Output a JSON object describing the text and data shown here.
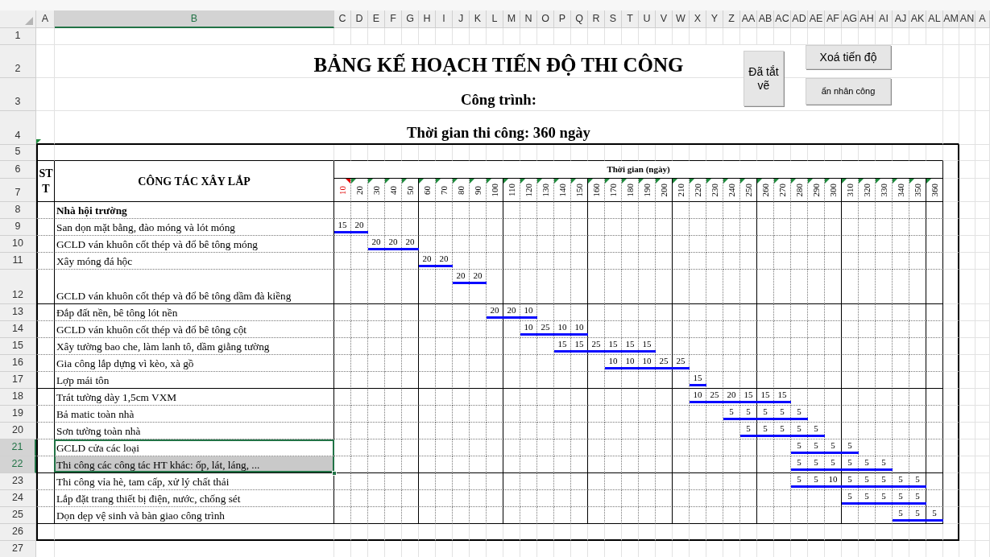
{
  "column_headers": [
    {
      "label": "A",
      "selected": false
    },
    {
      "label": "B",
      "selected": true
    },
    {
      "label": "C",
      "selected": false
    },
    {
      "label": "D",
      "selected": false
    },
    {
      "label": "E",
      "selected": false
    },
    {
      "label": "F",
      "selected": false
    },
    {
      "label": "G",
      "selected": false
    },
    {
      "label": "H",
      "selected": false
    },
    {
      "label": "I",
      "selected": false
    },
    {
      "label": "J",
      "selected": false
    },
    {
      "label": "K",
      "selected": false
    },
    {
      "label": "L",
      "selected": false
    },
    {
      "label": "M",
      "selected": false
    },
    {
      "label": "N",
      "selected": false
    },
    {
      "label": "O",
      "selected": false
    },
    {
      "label": "P",
      "selected": false
    },
    {
      "label": "Q",
      "selected": false
    },
    {
      "label": "R",
      "selected": false
    },
    {
      "label": "S",
      "selected": false
    },
    {
      "label": "T",
      "selected": false
    },
    {
      "label": "U",
      "selected": false
    },
    {
      "label": "V",
      "selected": false
    },
    {
      "label": "W",
      "selected": false
    },
    {
      "label": "X",
      "selected": false
    },
    {
      "label": "Y",
      "selected": false
    },
    {
      "label": "Z",
      "selected": false
    },
    {
      "label": "AA",
      "selected": false
    },
    {
      "label": "AB",
      "selected": false
    },
    {
      "label": "AC",
      "selected": false
    },
    {
      "label": "AD",
      "selected": false
    },
    {
      "label": "AE",
      "selected": false
    },
    {
      "label": "AF",
      "selected": false
    },
    {
      "label": "AG",
      "selected": false
    },
    {
      "label": "AH",
      "selected": false
    },
    {
      "label": "AI",
      "selected": false
    },
    {
      "label": "AJ",
      "selected": false
    },
    {
      "label": "AK",
      "selected": false
    },
    {
      "label": "AL",
      "selected": false
    },
    {
      "label": "AM",
      "selected": false
    },
    {
      "label": "AN",
      "selected": false
    },
    {
      "label": "A",
      "selected": false
    }
  ],
  "row_numbers": [
    {
      "label": "1",
      "selected": false
    },
    {
      "label": "2",
      "selected": false
    },
    {
      "label": "3",
      "selected": false
    },
    {
      "label": "4",
      "selected": false
    },
    {
      "label": "5",
      "selected": false
    },
    {
      "label": "6",
      "selected": false
    },
    {
      "label": "7",
      "selected": false
    },
    {
      "label": "8",
      "selected": false
    },
    {
      "label": "9",
      "selected": false
    },
    {
      "label": "10",
      "selected": false
    },
    {
      "label": "11",
      "selected": false
    },
    {
      "label": "12",
      "selected": false
    },
    {
      "label": "13",
      "selected": false
    },
    {
      "label": "14",
      "selected": false
    },
    {
      "label": "15",
      "selected": false
    },
    {
      "label": "16",
      "selected": false
    },
    {
      "label": "17",
      "selected": false
    },
    {
      "label": "18",
      "selected": false
    },
    {
      "label": "19",
      "selected": false
    },
    {
      "label": "20",
      "selected": false
    },
    {
      "label": "21",
      "selected": true
    },
    {
      "label": "22",
      "selected": true
    },
    {
      "label": "23",
      "selected": false
    },
    {
      "label": "24",
      "selected": false
    },
    {
      "label": "25",
      "selected": false
    },
    {
      "label": "26",
      "selected": false
    },
    {
      "label": "27",
      "selected": false
    }
  ],
  "title": "BẢNG KẾ HOẠCH TIẾN ĐỘ THI CÔNG",
  "project_label": "Công trình:",
  "duration": "Thời gian thi công: 360 ngày",
  "buttons": [
    {
      "label": "Đã tắt vẽ"
    },
    {
      "label": "Xoá tiến độ"
    },
    {
      "label": "ẩn nhân công"
    }
  ],
  "table": {
    "col_stt": "STT",
    "col_task": "CÔNG TÁC XÂY LẮP",
    "time_header": "Thời gian (ngày)",
    "days": [
      {
        "label": "10",
        "flagged": true
      },
      {
        "label": "20",
        "flagged": false
      },
      {
        "label": "30",
        "flagged": false
      },
      {
        "label": "40",
        "flagged": false
      },
      {
        "label": "50",
        "flagged": false
      },
      {
        "label": "60",
        "flagged": false
      },
      {
        "label": "70",
        "flagged": false
      },
      {
        "label": "80",
        "flagged": false
      },
      {
        "label": "90",
        "flagged": false
      },
      {
        "label": "100",
        "flagged": false
      },
      {
        "label": "110",
        "flagged": false
      },
      {
        "label": "120",
        "flagged": false
      },
      {
        "label": "130",
        "flagged": false
      },
      {
        "label": "140",
        "flagged": false
      },
      {
        "label": "150",
        "flagged": false
      },
      {
        "label": "160",
        "flagged": false
      },
      {
        "label": "170",
        "flagged": false
      },
      {
        "label": "180",
        "flagged": false
      },
      {
        "label": "190",
        "flagged": false
      },
      {
        "label": "200",
        "flagged": false
      },
      {
        "label": "210",
        "flagged": false
      },
      {
        "label": "220",
        "flagged": false
      },
      {
        "label": "230",
        "flagged": false
      },
      {
        "label": "240",
        "flagged": false
      },
      {
        "label": "250",
        "flagged": false
      },
      {
        "label": "260",
        "flagged": false
      },
      {
        "label": "270",
        "flagged": false
      },
      {
        "label": "280",
        "flagged": false
      },
      {
        "label": "290",
        "flagged": false
      },
      {
        "label": "300",
        "flagged": false
      },
      {
        "label": "310",
        "flagged": false
      },
      {
        "label": "320",
        "flagged": false
      },
      {
        "label": "330",
        "flagged": false
      },
      {
        "label": "340",
        "flagged": false
      },
      {
        "label": "350",
        "flagged": false
      },
      {
        "label": "360",
        "flagged": false
      }
    ],
    "rows": [
      {
        "kind": "group",
        "task": "Nhà hội trường",
        "selected": false,
        "shaded": false
      },
      {
        "kind": "task",
        "task": "San dọn mặt bằng, đào móng và lót móng",
        "selected": false,
        "shaded": false,
        "cells": [
          "15",
          "20"
        ]
      },
      {
        "kind": "task",
        "task": "GCLD ván khuôn cốt thép và đổ bê tông móng",
        "selected": false,
        "shaded": false,
        "cells": [
          null,
          null,
          "20",
          "20",
          "20"
        ]
      },
      {
        "kind": "task",
        "task": "Xây móng đá hộc",
        "selected": false,
        "shaded": false,
        "cells": [
          null,
          null,
          null,
          null,
          null,
          "20",
          "20"
        ]
      },
      {
        "kind": "task",
        "task": "GCLD ván khuôn cốt thép và đổ bê tông dầm đà kiềng",
        "selected": false,
        "shaded": false,
        "cells": [
          null,
          null,
          null,
          null,
          null,
          null,
          null,
          "20",
          "20"
        ]
      },
      {
        "kind": "task",
        "task": "Đắp đất nền, bê tông lót nền",
        "selected": false,
        "shaded": false,
        "cells": [
          null,
          null,
          null,
          null,
          null,
          null,
          null,
          null,
          null,
          "20",
          "20",
          "10"
        ]
      },
      {
        "kind": "task",
        "task": "GCLD ván khuôn cốt thép và đổ bê tông cột",
        "selected": false,
        "shaded": false,
        "cells": [
          null,
          null,
          null,
          null,
          null,
          null,
          null,
          null,
          null,
          null,
          null,
          "10",
          "25",
          "10",
          "10"
        ]
      },
      {
        "kind": "task",
        "task": "Xây tường bao che, làm lanh tô, dầm giằng tường",
        "selected": false,
        "shaded": false,
        "cells": [
          null,
          null,
          null,
          null,
          null,
          null,
          null,
          null,
          null,
          null,
          null,
          null,
          null,
          "15",
          "15",
          "25",
          "15",
          "15",
          "15"
        ]
      },
      {
        "kind": "task",
        "task": "Gia công lắp dựng vì kèo, xà gồ",
        "selected": false,
        "shaded": false,
        "cells": [
          null,
          null,
          null,
          null,
          null,
          null,
          null,
          null,
          null,
          null,
          null,
          null,
          null,
          null,
          null,
          null,
          "10",
          "10",
          "10",
          "25",
          "25"
        ]
      },
      {
        "kind": "task",
        "task": "Lợp mái tôn",
        "selected": false,
        "shaded": false,
        "cells": [
          null,
          null,
          null,
          null,
          null,
          null,
          null,
          null,
          null,
          null,
          null,
          null,
          null,
          null,
          null,
          null,
          null,
          null,
          null,
          null,
          null,
          "15"
        ]
      },
      {
        "kind": "task",
        "task": "Trát tường dày 1,5cm VXM",
        "selected": false,
        "shaded": false,
        "cells": [
          null,
          null,
          null,
          null,
          null,
          null,
          null,
          null,
          null,
          null,
          null,
          null,
          null,
          null,
          null,
          null,
          null,
          null,
          null,
          null,
          null,
          "10",
          "25",
          "20",
          "15",
          "15",
          "15"
        ]
      },
      {
        "kind": "task",
        "task": "Bả matic toàn nhà",
        "selected": false,
        "shaded": false,
        "cells": [
          null,
          null,
          null,
          null,
          null,
          null,
          null,
          null,
          null,
          null,
          null,
          null,
          null,
          null,
          null,
          null,
          null,
          null,
          null,
          null,
          null,
          null,
          null,
          "5",
          "5",
          "5",
          "5",
          "5"
        ]
      },
      {
        "kind": "task",
        "task": "Sơn tường toàn nhà",
        "selected": false,
        "shaded": false,
        "cells": [
          null,
          null,
          null,
          null,
          null,
          null,
          null,
          null,
          null,
          null,
          null,
          null,
          null,
          null,
          null,
          null,
          null,
          null,
          null,
          null,
          null,
          null,
          null,
          null,
          "5",
          "5",
          "5",
          "5",
          "5"
        ]
      },
      {
        "kind": "task",
        "task": "GCLD cửa các loại",
        "selected": true,
        "shaded": false,
        "cells": [
          null,
          null,
          null,
          null,
          null,
          null,
          null,
          null,
          null,
          null,
          null,
          null,
          null,
          null,
          null,
          null,
          null,
          null,
          null,
          null,
          null,
          null,
          null,
          null,
          null,
          null,
          null,
          "5",
          "5",
          "5",
          "5"
        ]
      },
      {
        "kind": "task",
        "task": "Thi công các công tác HT khác: ốp, lát, láng, ...",
        "selected": true,
        "shaded": true,
        "cells": [
          null,
          null,
          null,
          null,
          null,
          null,
          null,
          null,
          null,
          null,
          null,
          null,
          null,
          null,
          null,
          null,
          null,
          null,
          null,
          null,
          null,
          null,
          null,
          null,
          null,
          null,
          null,
          "5",
          "5",
          "5",
          "5",
          "5",
          "5"
        ]
      },
      {
        "kind": "task",
        "task": "Thi công vỉa hè, tam cấp, xử lý chất thải",
        "selected": false,
        "shaded": false,
        "cells": [
          null,
          null,
          null,
          null,
          null,
          null,
          null,
          null,
          null,
          null,
          null,
          null,
          null,
          null,
          null,
          null,
          null,
          null,
          null,
          null,
          null,
          null,
          null,
          null,
          null,
          null,
          null,
          "5",
          "5",
          "10",
          "5",
          "5",
          "5",
          "5",
          "5"
        ]
      },
      {
        "kind": "task",
        "task": "Lắp đặt trang thiết bị điện, nước, chống sét",
        "selected": false,
        "shaded": false,
        "cells": [
          null,
          null,
          null,
          null,
          null,
          null,
          null,
          null,
          null,
          null,
          null,
          null,
          null,
          null,
          null,
          null,
          null,
          null,
          null,
          null,
          null,
          null,
          null,
          null,
          null,
          null,
          null,
          null,
          null,
          null,
          "5",
          "5",
          "5",
          "5",
          "5"
        ]
      },
      {
        "kind": "task",
        "task": "Dọn dẹp vệ sinh và bàn giao công trình",
        "selected": false,
        "shaded": false,
        "cells": [
          null,
          null,
          null,
          null,
          null,
          null,
          null,
          null,
          null,
          null,
          null,
          null,
          null,
          null,
          null,
          null,
          null,
          null,
          null,
          null,
          null,
          null,
          null,
          null,
          null,
          null,
          null,
          null,
          null,
          null,
          null,
          null,
          null,
          "5",
          "5",
          "5"
        ]
      }
    ]
  }
}
